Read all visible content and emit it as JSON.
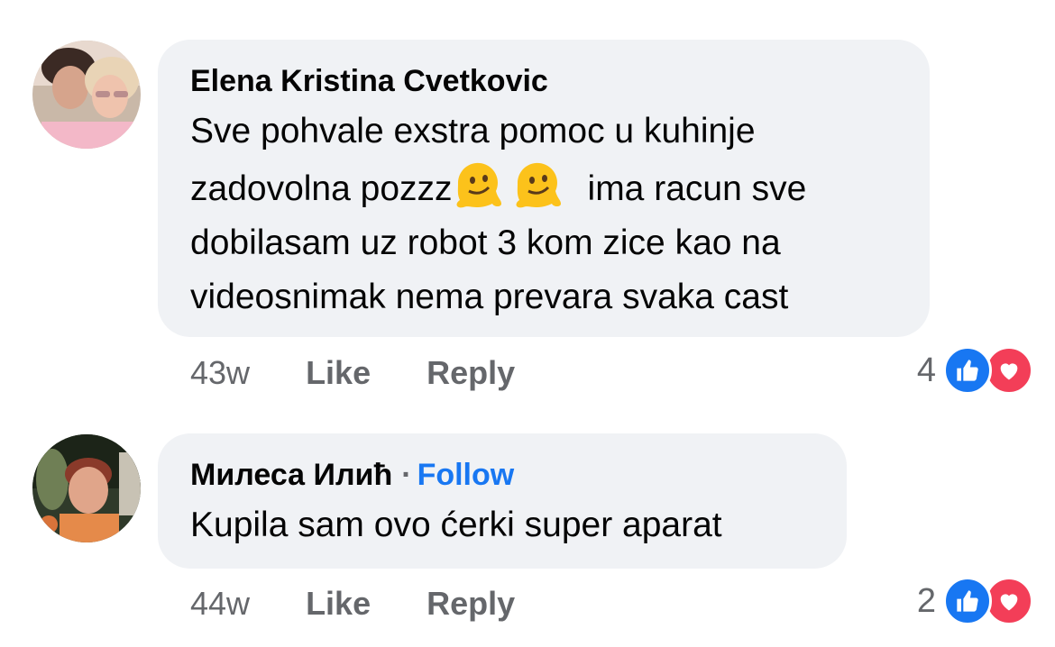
{
  "comments": [
    {
      "author": "Elena Kristina Cvetkovic",
      "text_line1": "Sve pohvale exstra pomoc u kuhinje",
      "text_line2_a": "zadovolna pozzz",
      "text_line2_b": "ima racun sve",
      "text_line3": "dobilasam uz robot  3 kom zice kao na",
      "text_line4": "videosnimak nema prevara svaka cast",
      "emojis": [
        "melting-face-icon",
        "melting-face-icon"
      ],
      "time": "43w",
      "like_label": "Like",
      "reply_label": "Reply",
      "reaction_count": "4",
      "reactions": [
        "like-icon",
        "love-icon"
      ]
    },
    {
      "author": "Милеса Илић",
      "separator": "·",
      "follow_label": "Follow",
      "text": "Kupila sam ovo ćerki super aparat",
      "time": "44w",
      "like_label": "Like",
      "reply_label": "Reply",
      "reaction_count": "2",
      "reactions": [
        "like-icon",
        "love-icon"
      ]
    }
  ],
  "colors": {
    "bubble": "#f0f2f5",
    "link": "#1877f2",
    "secondary_text": "#65676b",
    "like": "#1877f2",
    "love": "#f33e58"
  }
}
